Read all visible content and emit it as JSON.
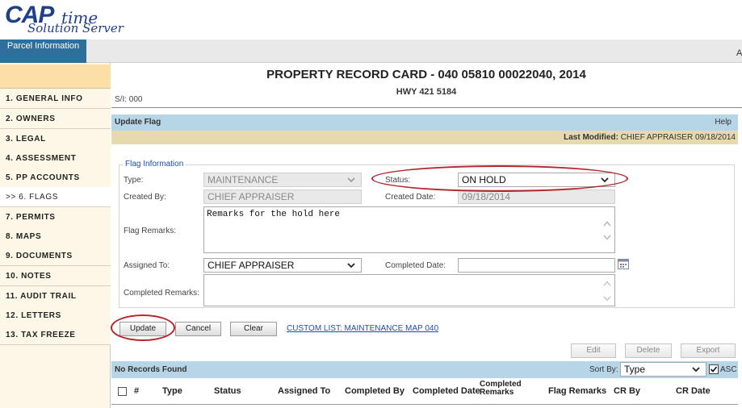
{
  "app": {
    "logo_cap": "CAP",
    "logo_time": "time",
    "logo_sub": "Solution Server",
    "top_tab": "Parcel Information",
    "top_right_fragment": "A"
  },
  "sidebar": {
    "items": [
      {
        "label": "1. GENERAL INFO"
      },
      {
        "label": "2. OWNERS"
      },
      {
        "label": "3. LEGAL"
      },
      {
        "label": "4. ASSESSMENT"
      },
      {
        "label": "5. PP ACCOUNTS"
      },
      {
        "label": ">> 6. FLAGS"
      },
      {
        "label": "7. PERMITS"
      },
      {
        "label": "8. MAPS"
      },
      {
        "label": "9. DOCUMENTS"
      },
      {
        "label": "10. NOTES"
      },
      {
        "label": "11. AUDIT TRAIL"
      },
      {
        "label": "12. LETTERS"
      },
      {
        "label": "13. TAX FREEZE"
      }
    ]
  },
  "header": {
    "title": "PROPERTY RECORD CARD - 040 05810 00022040, 2014",
    "address": "HWY 421 5184",
    "sl": "S/I: 000"
  },
  "update_flag": {
    "section_label": "Update Flag",
    "help": "Help",
    "last_modified_label": "Last Modified:",
    "last_modified_value": "CHIEF APPRAISER 09/18/2014"
  },
  "form": {
    "legend": "Flag Information",
    "type_label": "Type:",
    "type_value": "MAINTENANCE",
    "status_label": "Status:",
    "status_value": "ON HOLD",
    "created_by_label": "Created By:",
    "created_by_value": "CHIEF APPRAISER",
    "created_date_label": "Created Date:",
    "created_date_value": "09/18/2014",
    "flag_remarks_label": "Flag Remarks:",
    "flag_remarks_value": "Remarks for the hold here",
    "assigned_to_label": "Assigned To:",
    "assigned_to_value": "CHIEF APPRAISER",
    "completed_date_label": "Completed Date:",
    "completed_date_value": "",
    "completed_remarks_label": "Completed Remarks:",
    "completed_remarks_value": ""
  },
  "actions": {
    "update": "Update",
    "cancel": "Cancel",
    "clear": "Clear",
    "custom_list": "CUSTOM LIST: MAINTENANCE MAP 040",
    "edit": "Edit",
    "delete": "Delete",
    "export": "Export"
  },
  "records": {
    "status": "No Records Found",
    "sort_label": "Sort By:",
    "sort_value": "Type",
    "asc_label": "ASC",
    "asc_checked": true,
    "columns": [
      "#",
      "Type",
      "Status",
      "Assigned To",
      "Completed By",
      "Completed Date",
      "Completed Remarks",
      "Flag Remarks",
      "CR By",
      "CR Date"
    ]
  },
  "colors": {
    "accent_blue": "#b6d6e8",
    "tan": "#e6d9ad",
    "sidebar_bg": "#fdf7e7",
    "highlight_oval": "#b3262b",
    "link": "#1a4fb0"
  }
}
